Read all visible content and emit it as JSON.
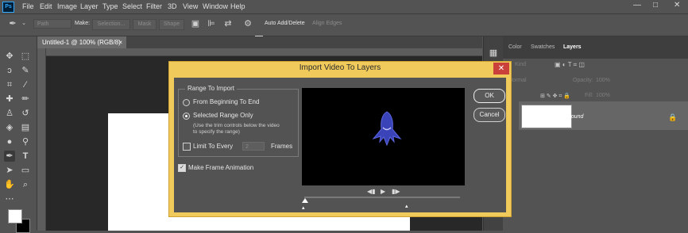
{
  "app": {
    "logo": "Ps"
  },
  "menu": [
    "File",
    "Edit",
    "Image",
    "Layer",
    "Type",
    "Select",
    "Filter",
    "3D",
    "View",
    "Window",
    "Help"
  ],
  "window_controls": {
    "minimize": "—",
    "maximize": "□",
    "close": "✕"
  },
  "options_bar": {
    "path_mode": "Path",
    "make_label": "Make:",
    "selection_btn": "Selection...",
    "mask_btn": "Mask",
    "shape_btn": "Shape",
    "auto_add_delete": "Auto Add/Delete",
    "align_edges": "Align Edges"
  },
  "document": {
    "tab_title": "Untitled-1 @ 100% (RGB/8)",
    "close": "×"
  },
  "panels": {
    "tabs": [
      "Color",
      "Swatches",
      "Layers"
    ],
    "active_tab": "Layers",
    "kind_label": "Kind",
    "blend_mode": "Normal",
    "opacity_label": "Opacity:",
    "opacity_value": "100%",
    "fill_label": "Fill:",
    "fill_value": "100%",
    "layer_name": "Background"
  },
  "dialog": {
    "title": "Import Video To Layers",
    "close": "✕",
    "range_group_label": "Range To Import",
    "option_all": "From Beginning To End",
    "option_selected": "Selected Range Only",
    "selected_note": "(Use the trim controls below the video to specify the range)",
    "limit_label": "Limit To Every",
    "limit_value": "2",
    "frames_label": "Frames",
    "make_frame_animation": "Make Frame Animation",
    "ok": "OK",
    "cancel": "Cancel",
    "selected_option": "selected",
    "limit_checked": false,
    "frame_animation_checked": true
  },
  "playback": {
    "prev": "◀▮",
    "play": "▶",
    "next": "▮▶"
  },
  "colors": {
    "dialog_frame": "#f0ca5b",
    "close_button": "#c9413a",
    "ui_dark": "#535353"
  }
}
